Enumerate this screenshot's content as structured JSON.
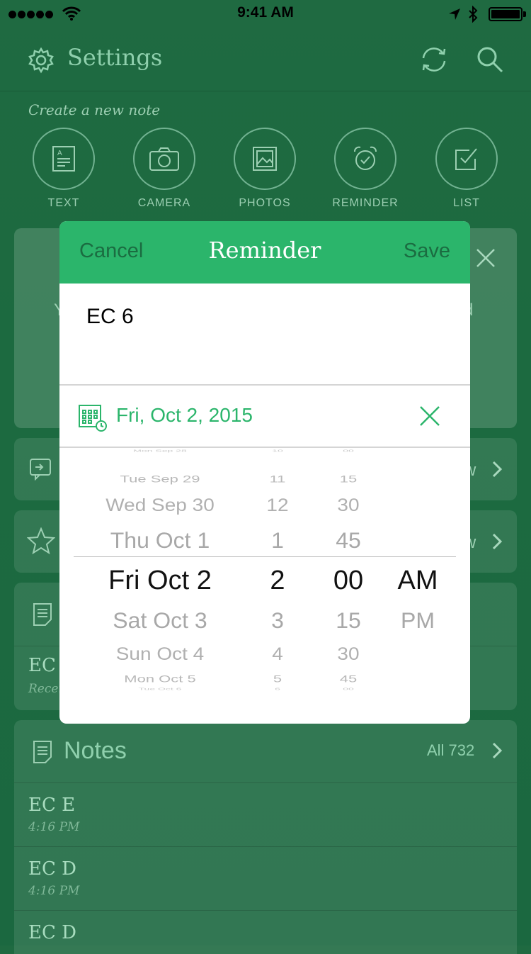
{
  "status_bar": {
    "time": "9:41 AM"
  },
  "nav": {
    "title": "Settings"
  },
  "create": {
    "label": "Create a new note",
    "items": [
      {
        "label": "TEXT",
        "icon": "text-note-icon"
      },
      {
        "label": "CAMERA",
        "icon": "camera-icon"
      },
      {
        "label": "PHOTOS",
        "icon": "photos-icon"
      },
      {
        "label": "REMINDER",
        "icon": "reminder-icon"
      },
      {
        "label": "LIST",
        "icon": "checklist-icon"
      }
    ]
  },
  "background_cards": {
    "shortcut_ec": {
      "title": "EC",
      "subtitle": "Recen"
    },
    "peek_left": "Y",
    "peek_right": "d",
    "peek_w1": "w",
    "peek_w2": "w"
  },
  "notes": {
    "title": "Notes",
    "count_label": "All 732",
    "rows": [
      {
        "title": "EC E",
        "time": "4:16 PM"
      },
      {
        "title": "EC D",
        "time": "4:16 PM"
      },
      {
        "title": "EC D",
        "time": ""
      }
    ]
  },
  "modal": {
    "cancel": "Cancel",
    "title": "Reminder",
    "save": "Save",
    "note_title": "EC 6",
    "date": "Fri, Oct 2, 2015",
    "picker": {
      "dates": [
        "Mon Sep 28",
        "Tue Sep 29",
        "Wed Sep 30",
        "Thu Oct 1",
        "Fri Oct 2",
        "Sat Oct 3",
        "Sun Oct 4",
        "Mon Oct 5",
        "Tue Oct 6"
      ],
      "hours": [
        "10",
        "11",
        "12",
        "1",
        "2",
        "3",
        "4",
        "5",
        "6"
      ],
      "minutes": [
        "00",
        "15",
        "30",
        "45",
        "00",
        "15",
        "30",
        "45",
        "00"
      ],
      "ampm": [
        "",
        "",
        "",
        "",
        "AM",
        "PM",
        "",
        "",
        ""
      ],
      "selected_index": 4
    }
  },
  "colors": {
    "accent": "#2bb56b",
    "background": "#1f6a41",
    "accent_dark": "#1b6c41"
  }
}
